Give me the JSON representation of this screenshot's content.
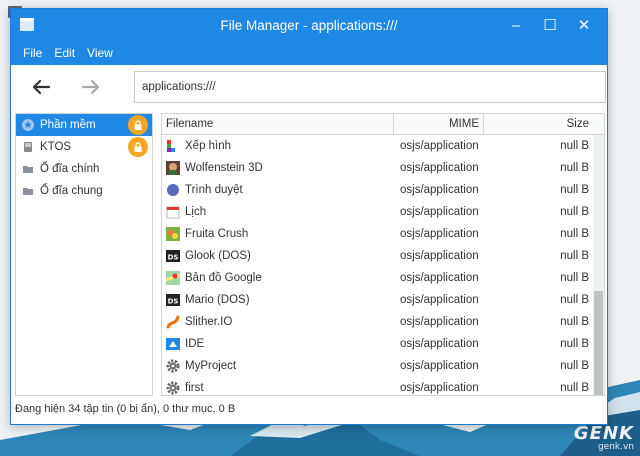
{
  "window": {
    "title": "File Manager - applications:///",
    "controls": {
      "minimize": "–",
      "maximize": "☐",
      "close": "✕"
    }
  },
  "menu": {
    "items": [
      "File",
      "Edit",
      "View"
    ]
  },
  "toolbar": {
    "back_icon": "arrow-left-icon",
    "forward_icon": "arrow-right-icon",
    "address_value": "applications:///"
  },
  "sidebar": {
    "items": [
      {
        "label": "Phần mềm",
        "icon": "star-icon",
        "active": true,
        "locked": true
      },
      {
        "label": "KTOS",
        "icon": "device-icon",
        "active": false,
        "locked": true
      },
      {
        "label": "Ổ đĩa chính",
        "icon": "folder-icon",
        "active": false,
        "locked": false
      },
      {
        "label": "Ổ đĩa chung",
        "icon": "folder-icon",
        "active": false,
        "locked": false
      }
    ]
  },
  "filelist": {
    "columns": {
      "name": "Filename",
      "mime": "MIME",
      "size": "Size"
    },
    "rows": [
      {
        "name": "Xếp hình",
        "mime": "osjs/application",
        "size": "null B",
        "icon": "tetris-icon"
      },
      {
        "name": "Wolfenstein 3D",
        "mime": "osjs/application",
        "size": "null B",
        "icon": "wolfenstein-icon"
      },
      {
        "name": "Trình duyệt",
        "mime": "osjs/application",
        "size": "null B",
        "icon": "browser-icon"
      },
      {
        "name": "Lịch",
        "mime": "osjs/application",
        "size": "null B",
        "icon": "calendar-icon"
      },
      {
        "name": "Fruita Crush",
        "mime": "osjs/application",
        "size": "null B",
        "icon": "fruit-icon"
      },
      {
        "name": "Glook (DOS)",
        "mime": "osjs/application",
        "size": "null B",
        "icon": "dos-icon"
      },
      {
        "name": "Bản đồ Google",
        "mime": "osjs/application",
        "size": "null B",
        "icon": "map-icon"
      },
      {
        "name": "Mario (DOS)",
        "mime": "osjs/application",
        "size": "null B",
        "icon": "dos-icon"
      },
      {
        "name": "Slither.IO",
        "mime": "osjs/application",
        "size": "null B",
        "icon": "slither-icon"
      },
      {
        "name": "IDE",
        "mime": "osjs/application",
        "size": "null B",
        "icon": "ide-icon"
      },
      {
        "name": "MyProject",
        "mime": "osjs/application",
        "size": "null B",
        "icon": "gear-icon"
      },
      {
        "name": "first",
        "mime": "osjs/application",
        "size": "null B",
        "icon": "gear-icon"
      }
    ]
  },
  "statusbar": {
    "text": "Đang hiện 34 tập tin (0 bị ẩn), 0 thư mục, 0 B"
  },
  "watermark": {
    "logo": "GENK",
    "url": "genk.vn"
  },
  "colors": {
    "accent": "#1e88e5",
    "lock": "#f5a623"
  }
}
